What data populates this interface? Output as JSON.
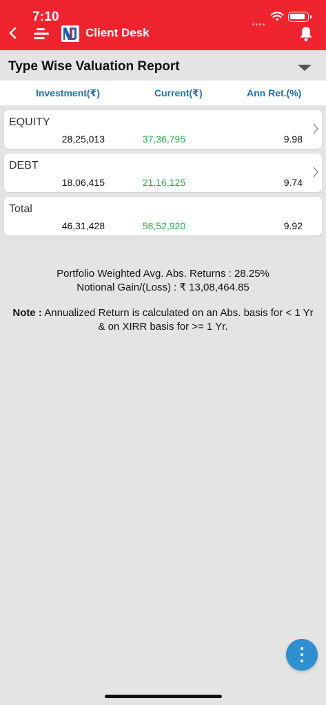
{
  "status_bar": {
    "time": "7:10"
  },
  "header": {
    "app_title": "Client Desk",
    "icons": [
      "back-icon",
      "menu-icon",
      "nj-logo",
      "bell-icon"
    ]
  },
  "report": {
    "title": "Type Wise Valuation Report",
    "dropdown_icon": "triangle-down-icon"
  },
  "columns": {
    "investment": "Investment(₹)",
    "current": "Current(₹)",
    "annual_return": "Ann Ret.(%)"
  },
  "rows": [
    {
      "type": "EQUITY",
      "investment": "28,25,013",
      "current": "37,36,795",
      "annual_return": "9.98",
      "has_chevron": true
    },
    {
      "type": "DEBT",
      "investment": "18,06,415",
      "current": "21,16,125",
      "annual_return": "9.74",
      "has_chevron": true
    },
    {
      "type": "Total",
      "investment": "46,31,428",
      "current": "58,52,920",
      "annual_return": "9.92",
      "has_chevron": false
    }
  ],
  "summary": {
    "weighted_returns": "Portfolio Weighted Avg. Abs. Returns : 28.25%",
    "notional_gain": "Notional Gain/(Loss) : ₹ 13,08,464.85"
  },
  "note": {
    "label": "Note :",
    "text": " Annualized Return is calculated on an Abs. basis for < 1 Yr & on XIRR basis for >= 1 Yr."
  },
  "colors": {
    "header_bg": "#f0242f",
    "column_header_text": "#1b6fb0",
    "current_value_text": "#2ea84a",
    "fab_bg": "#2f8fd0",
    "page_bg": "#e4e4e4"
  }
}
